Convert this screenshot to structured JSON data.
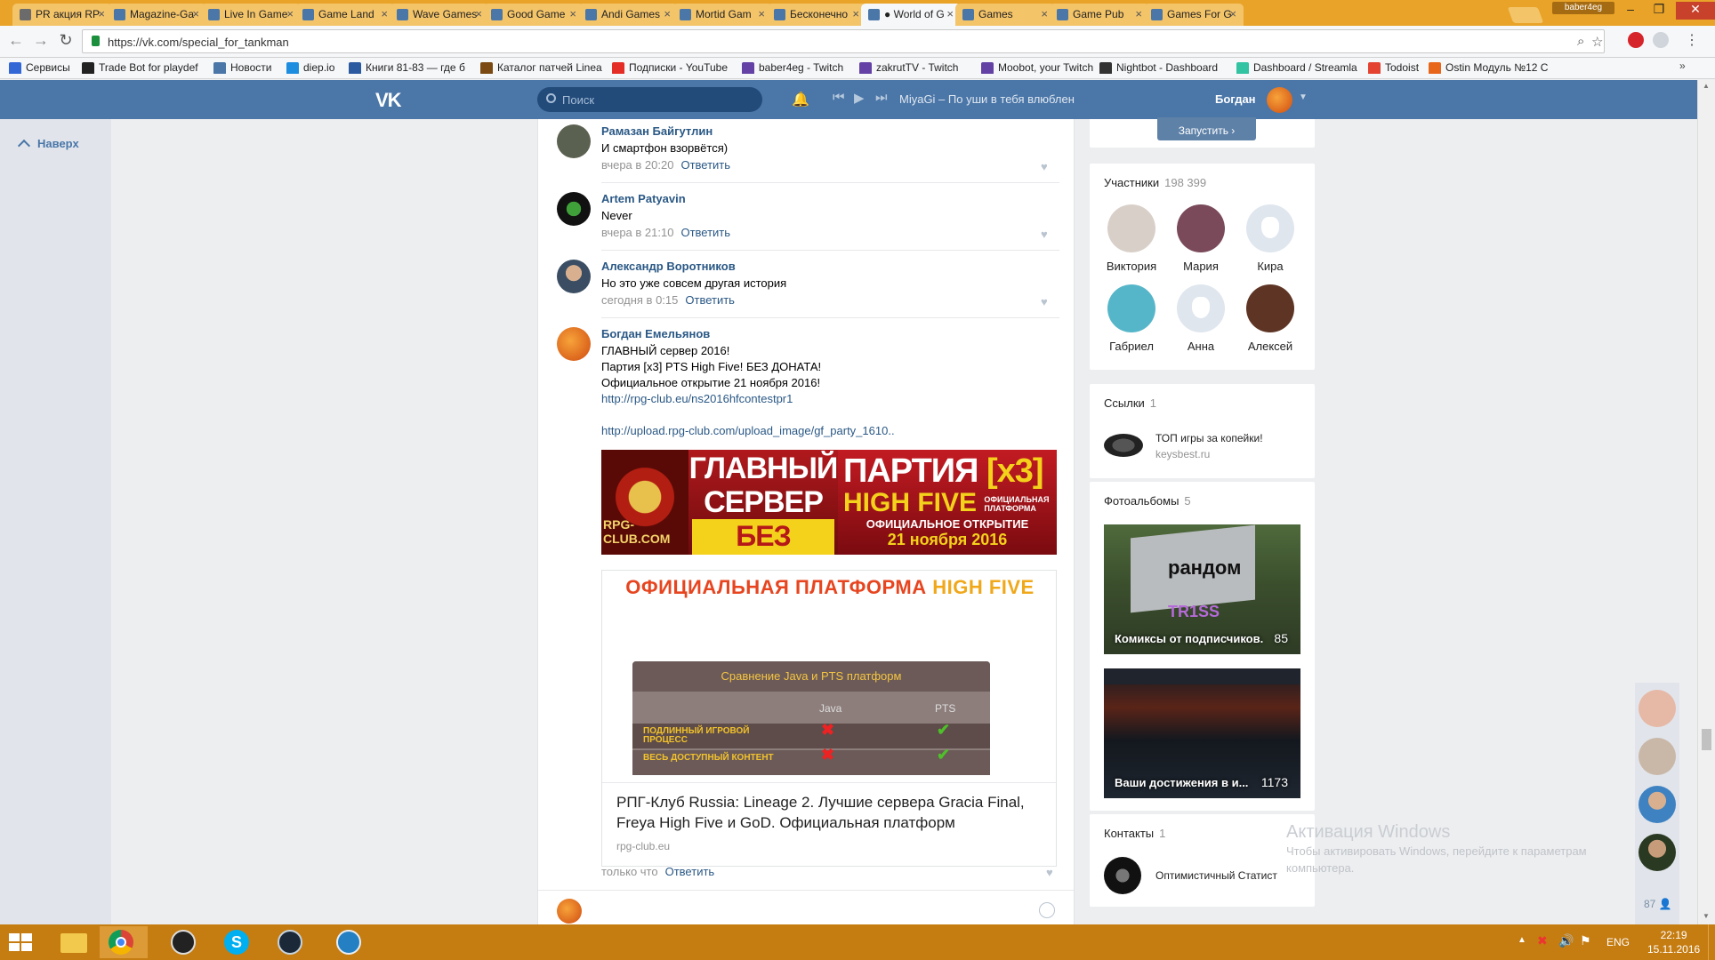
{
  "browser": {
    "tabs": [
      {
        "label": "PR акция RP",
        "icon": "pr-favicon",
        "active": false
      },
      {
        "label": "Magazine-Ga",
        "icon": "vk-favicon",
        "active": false
      },
      {
        "label": "Live In Game",
        "icon": "vk-favicon",
        "active": false
      },
      {
        "label": "Game Land",
        "icon": "vk-favicon",
        "active": false
      },
      {
        "label": "Wave Games",
        "icon": "vk-favicon",
        "active": false
      },
      {
        "label": "Good Game",
        "icon": "vk-favicon",
        "active": false
      },
      {
        "label": "Andi Games",
        "icon": "vk-favicon",
        "active": false
      },
      {
        "label": "Mortid Gam",
        "icon": "vk-favicon",
        "active": false
      },
      {
        "label": "Бесконечно",
        "icon": "vk-favicon",
        "active": false
      },
      {
        "label": "● World of G",
        "icon": "vk-favicon",
        "active": true
      },
      {
        "label": "Games",
        "icon": "vk-favicon",
        "active": false
      },
      {
        "label": "Game Pub",
        "icon": "vk-favicon",
        "active": false
      },
      {
        "label": "Games For G",
        "icon": "vk-favicon",
        "active": false
      }
    ],
    "profile_badge": "baber4eg",
    "url": "https://vk.com/special_for_tankman",
    "bookmarks": [
      {
        "label": "Сервисы",
        "icon": "apps-grid-icon",
        "color": "#3367d6"
      },
      {
        "label": "Trade Bot for playdef",
        "icon": "trade-bot-icon",
        "color": "#222222"
      },
      {
        "label": "Новости",
        "icon": "vk-favicon",
        "color": "#4a76a8"
      },
      {
        "label": "diep.io",
        "icon": "diep-icon",
        "color": "#1d8de0"
      },
      {
        "label": "Книги 81-83 — где б",
        "icon": "books-icon",
        "color": "#2c5aa0"
      },
      {
        "label": "Каталог патчей Linea",
        "icon": "catalog-icon",
        "color": "#7a4a12"
      },
      {
        "label": "Подписки - YouTube",
        "icon": "youtube-icon",
        "color": "#e52d27"
      },
      {
        "label": "baber4eg - Twitch",
        "icon": "twitch-icon",
        "color": "#6441a5"
      },
      {
        "label": "zakrutTV - Twitch",
        "icon": "twitch-icon",
        "color": "#6441a5"
      },
      {
        "label": "Moobot, your Twitch",
        "icon": "twitch-icon",
        "color": "#6441a5"
      },
      {
        "label": "Nightbot - Dashboard",
        "icon": "nightbot-icon",
        "color": "#333333"
      },
      {
        "label": "Dashboard / Streamla",
        "icon": "streamlabs-icon",
        "color": "#31c3a2"
      },
      {
        "label": "Todoist",
        "icon": "todoist-icon",
        "color": "#e44332"
      },
      {
        "label": "Ostin Модуль №12 С",
        "icon": "ostin-icon",
        "color": "#e8661b"
      }
    ]
  },
  "vk_header": {
    "logo": "VK",
    "search_placeholder": "Поиск",
    "now_playing": "MiyaGi – По уши в тебя влюблен",
    "user_name": "Богдан"
  },
  "left_nav": {
    "up_label": "Наверх"
  },
  "comments": [
    {
      "author": "Рамазан Байгутлин",
      "text": "И смартфон взорвётся)",
      "time": "вчера в 20:20",
      "reply": "Ответить",
      "avatar_color": "#5b6150"
    },
    {
      "author": "Artem Patyavin",
      "text": "Never",
      "time": "вчера в 21:10",
      "reply": "Ответить",
      "avatar_color": "#1c2a18"
    },
    {
      "author": "Александр Воротников",
      "text": "Но это уже совсем другая история",
      "time": "сегодня в 0:15",
      "reply": "Ответить",
      "avatar_color": "#3a4d63"
    },
    {
      "author": "Богдан Емельянов",
      "text": "ГЛАВНЫЙ сервер 2016!\nПартия [x3] PTS High Five! БЕЗ ДОНАТА!\nОфициальное открытие 21 ноября 2016!",
      "link1": "http://rpg-club.eu/ns2016hfcontestpr1",
      "link2": "http://upload.rpg-club.com/upload_image/gf_party_1610..",
      "time": "только что",
      "reply": "Ответить",
      "avatar_color": "#e06a1c"
    }
  ],
  "banner": {
    "logo_text": "RPG-CLUB.COM",
    "main_l1": "ГЛАВНЫЙ",
    "main_l2": "СЕРВЕР",
    "main_l3": "БЕЗ ДОНАТА",
    "party_l1a": "ПАРТИЯ ",
    "party_l1b": "[x3]",
    "party_l2": "HIGH FIVE",
    "party_small": "ОФИЦИАЛЬНАЯ ПЛАТФОРМА",
    "open_l1": "ОФИЦИАЛЬНОЕ ОТКРЫТИЕ",
    "open_l2": "21 ноября 2016"
  },
  "attachment": {
    "title_a": "ОФИЦИАЛЬНАЯ ПЛАТФОРМА ",
    "title_b": "HIGH FIVE",
    "table_title": "Сравнение Java и PTS платформ",
    "col1": "Java",
    "col2": "PTS",
    "row1": "ПОДЛИННЫЙ ИГРОВОЙ ПРОЦЕСС",
    "row2": "ВЕСЬ ДОСТУПНЫЙ КОНТЕНТ",
    "text": "РПГ-Клуб Russia: Lineage 2. Лучшие сервера Gracia Final, Freya High Five и GoD. Официальная платформ",
    "domain": "rpg-club.eu"
  },
  "sidebar": {
    "launch_button": "Запустить ›",
    "members_title": "Участники",
    "members_count": "198 399",
    "members": [
      {
        "name": "Виктория",
        "color": "#d8cfc8"
      },
      {
        "name": "Мария",
        "color": "#7a4a5a"
      },
      {
        "name": "Кира",
        "color": "dog"
      },
      {
        "name": "Габриел",
        "color": "#56b6c9"
      },
      {
        "name": "Анна",
        "color": "dog"
      },
      {
        "name": "Алексей",
        "color": "#5e3424"
      }
    ],
    "links_title": "Ссылки",
    "links_count": "1",
    "link_title": "ТОП игры за копейки!",
    "link_domain": "keysbest.ru",
    "albums_title": "Фотоальбомы",
    "albums_count": "5",
    "albums": [
      {
        "caption": "Комиксы от подписчиков.",
        "count": "85",
        "overlay1": "рандом",
        "overlay2": "TR1SS"
      },
      {
        "caption": "Ваши достижения в и...",
        "count": "1173"
      }
    ],
    "contacts_title": "Контакты",
    "contacts_count": "1",
    "contact_name": "Оптимистичный Статист"
  },
  "watermark": {
    "line1": "Активация Windows",
    "line2": "Чтобы активировать Windows, перейдите к параметрам",
    "line3": "компьютера."
  },
  "friends_online": "87",
  "taskbar": {
    "lang": "ENG",
    "time": "22:19",
    "date": "15.11.2016"
  }
}
